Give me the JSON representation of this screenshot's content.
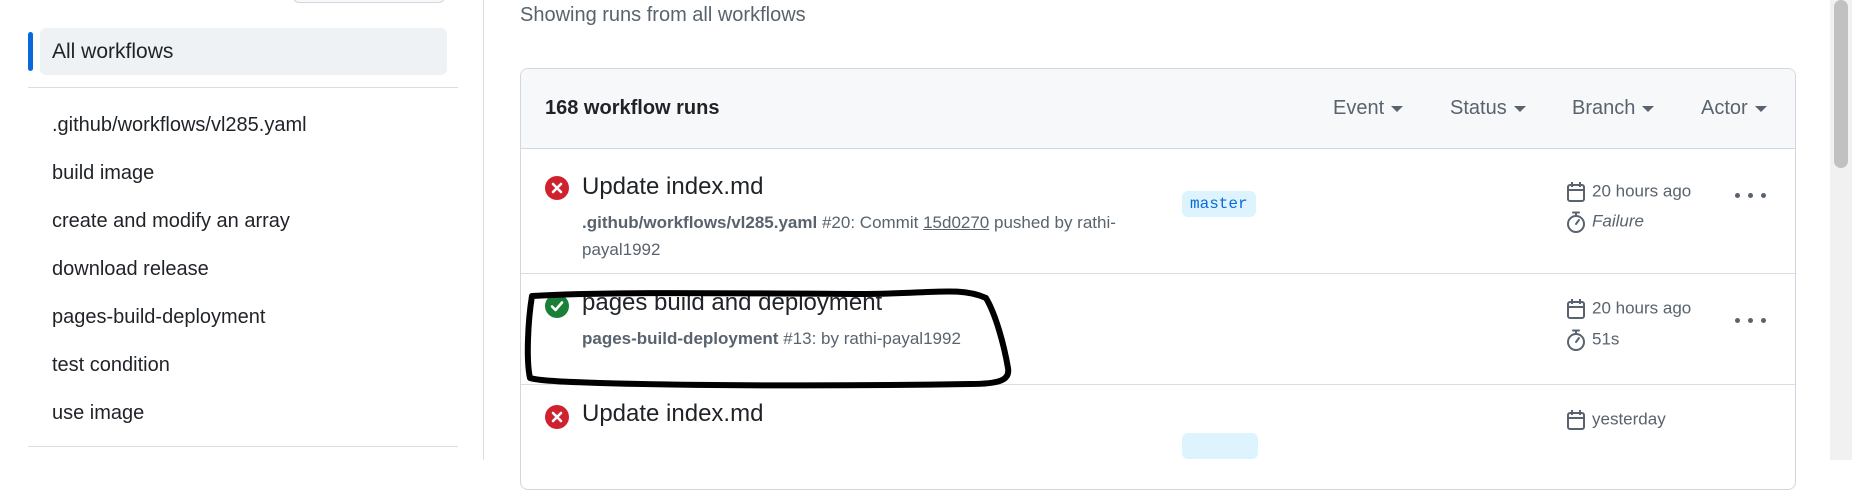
{
  "sidebar": {
    "active_item": "All workflows",
    "items": [
      ".github/workflows/vl285.yaml",
      "build image",
      "create and modify an array",
      "download release",
      "pages-build-deployment",
      "test condition",
      "use image"
    ]
  },
  "main": {
    "showing_text": "Showing runs from all workflows",
    "runs_count": "168 workflow runs",
    "filters": {
      "event": "Event",
      "status": "Status",
      "branch": "Branch",
      "actor": "Actor"
    },
    "runs": [
      {
        "status": "failure",
        "title": "Update index.md",
        "workflow": ".github/workflows/vl285.yaml",
        "run_number": "#20",
        "prefix": ": Commit ",
        "sha": "15d0270",
        "actor_line1": " pushed by rathi-",
        "actor_line2": "payal1992",
        "branch": "master",
        "time": "20 hours ago",
        "duration": "Failure"
      },
      {
        "status": "success",
        "title": "pages build and deployment",
        "workflow": "pages-build-deployment",
        "run_number": "#13",
        "meta_suffix": ": by rathi-payal1992",
        "time": "20 hours ago",
        "duration": "51s"
      },
      {
        "status": "failure",
        "title": "Update index.md",
        "time": "yesterday"
      }
    ]
  },
  "colors": {
    "accent": "#0969da",
    "failure": "#cf222e",
    "success": "#1a7f37",
    "annotation": "#000000"
  }
}
